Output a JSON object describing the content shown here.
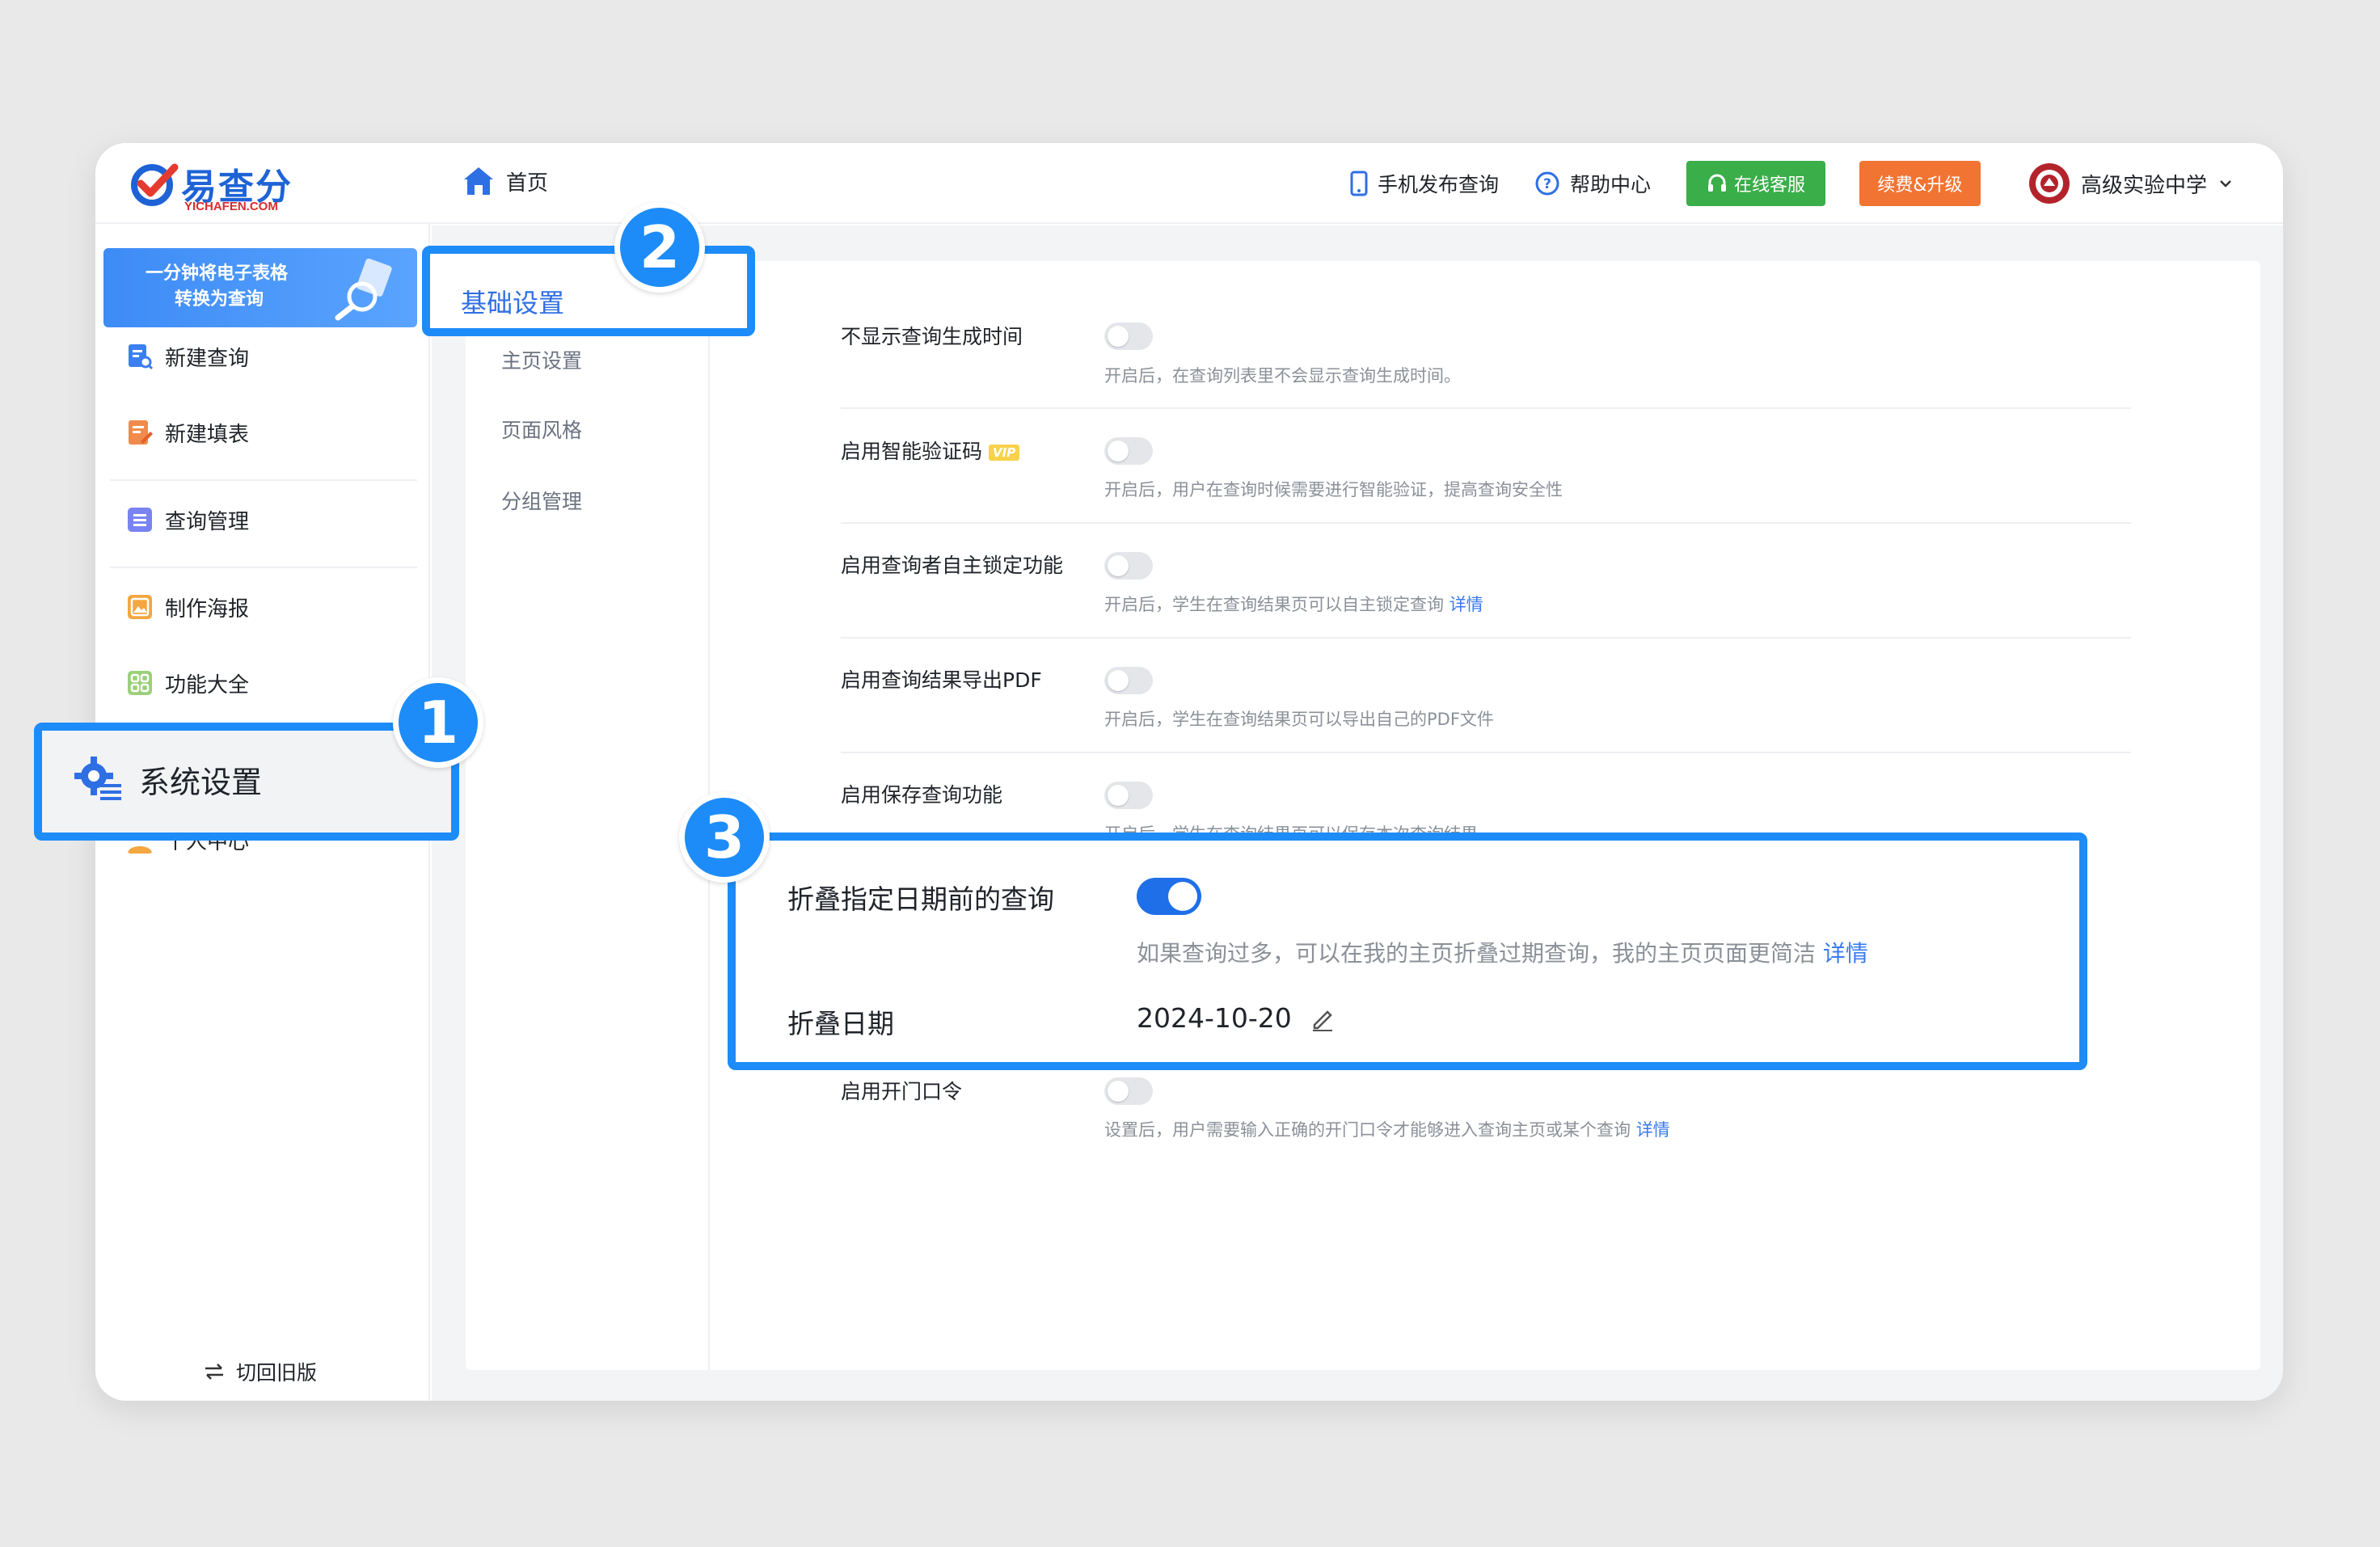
{
  "header": {
    "logo_text": "易查分",
    "logo_sub": "YICHAFEN.COM",
    "home_label": "首页",
    "mobile_publish": "手机发布查询",
    "help_center": "帮助中心",
    "online_service": "在线客服",
    "renew_upgrade": "续费&升级",
    "school_name": "高级实验中学"
  },
  "sidebar": {
    "banner_line1": "一分钟将电子表格",
    "banner_line2": "转换为查询",
    "items": [
      {
        "label": "新建查询"
      },
      {
        "label": "新建填表"
      },
      {
        "label": "查询管理"
      },
      {
        "label": "制作海报"
      },
      {
        "label": "功能大全"
      },
      {
        "label": "系统设置"
      },
      {
        "label": "个人中心"
      }
    ],
    "switch_old": "切回旧版"
  },
  "submenu": {
    "items": [
      {
        "label": "基础设置"
      },
      {
        "label": "主页设置"
      },
      {
        "label": "页面风格"
      },
      {
        "label": "分组管理"
      }
    ]
  },
  "settings": [
    {
      "title": "不显示查询生成时间",
      "desc": "开启后，在查询列表里不会显示查询生成时间。"
    },
    {
      "title": "启用智能验证码",
      "badge": "VIP",
      "desc": "开启后，用户在查询时候需要进行智能验证，提高查询安全性"
    },
    {
      "title": "启用查询者自主锁定功能",
      "desc": "开启后，学生在查询结果页可以自主锁定查询",
      "link": "详情"
    },
    {
      "title": "启用查询结果导出PDF",
      "desc": "开启后，学生在查询结果页可以导出自己的PDF文件"
    },
    {
      "title": "启用保存查询功能",
      "desc": "开启后，学生在查询结果页可以保存本次查询结果"
    },
    {
      "title": "启用开门口令",
      "desc": "设置后，用户需要输入正确的开门口令才能够进入查询主页或某个查询",
      "link": "详情"
    }
  ],
  "callout": {
    "fold_title": "折叠指定日期前的查询",
    "fold_desc": "如果查询过多，可以在我的主页折叠过期查询，我的主页页面更简洁",
    "fold_link": "详情",
    "fold_enabled": true,
    "date_label": "折叠日期",
    "date_value": "2024-10-20"
  },
  "badges": {
    "one": "1",
    "two": "2",
    "three": "3"
  },
  "colors": {
    "accent": "#1d8cf8",
    "toggle_on": "#1f6fe8",
    "green": "#3aae49",
    "orange": "#f27433",
    "link": "#3a7bf0"
  }
}
